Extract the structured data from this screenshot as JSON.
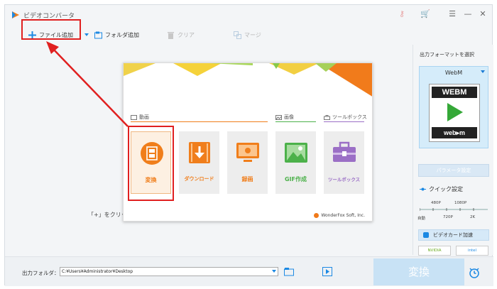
{
  "app": {
    "title": "ビデオコンバータ"
  },
  "toolbar": {
    "add_file": "ファイル追加",
    "add_folder": "フォルダ追加",
    "clear": "クリア",
    "merge": "マージ"
  },
  "main": {
    "hint": "「+」をクリッ"
  },
  "popup": {
    "sections": {
      "video": "動画",
      "image": "画像",
      "toolbox": "ツールボックス"
    },
    "tiles": [
      {
        "label": "変換",
        "icon": "film-icon",
        "color": "#f07e1b"
      },
      {
        "label": "ダウンロード",
        "icon": "download-icon",
        "color": "#f07e1b"
      },
      {
        "label": "録画",
        "icon": "screen-record-icon",
        "color": "#f07e1b"
      },
      {
        "label": "GIF作成",
        "icon": "image-icon",
        "color": "#4cb14a"
      },
      {
        "label": "ツールボックス",
        "icon": "toolbox-icon",
        "color": "#9b6fc6"
      }
    ],
    "brand": "WonderFox Soft, Inc."
  },
  "right_panel": {
    "title": "出力フォーマットを選択",
    "format": "WebM",
    "icon_top": "WEBM",
    "icon_bottom": "web▸m",
    "param_button": "パラメータ設定",
    "quick_label": "クイック設定",
    "q_top": [
      "480P",
      "1080P"
    ],
    "q_bottom": [
      "自動",
      "720P",
      "2K"
    ],
    "accel": "ビデオカード加速",
    "gpu": [
      "NVIDIA",
      "intel"
    ]
  },
  "bottom": {
    "output_label": "出力フォルダ：",
    "output_path": "C:¥Users¥Administrator¥Desktop",
    "convert": "変換"
  },
  "colors": {
    "accent_blue": "#1c89e3",
    "highlight_red": "#e02020",
    "orange": "#f07e1b"
  }
}
